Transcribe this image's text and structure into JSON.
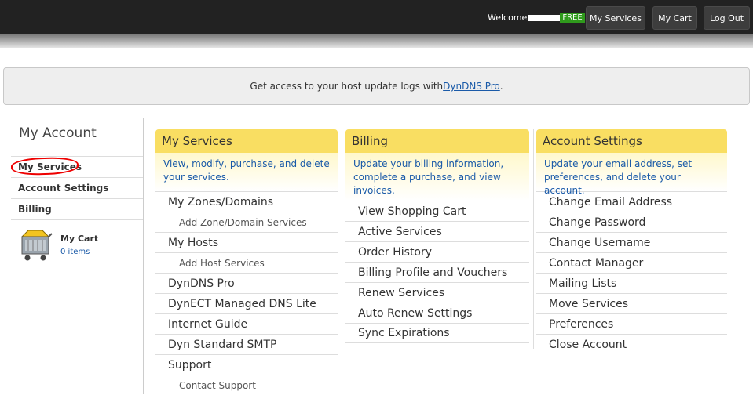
{
  "topbar": {
    "welcome_label": "Welcome",
    "badge": "FREE",
    "buttons": [
      "My Services",
      "My Cart",
      "Log Out"
    ]
  },
  "banner": {
    "text_before": "Get access to your host update logs with ",
    "link": "DynDNS Pro",
    "text_after": "."
  },
  "sidebar": {
    "title": "My Account",
    "links": [
      "My Services",
      "Account Settings",
      "Billing"
    ],
    "cart_title": "My Cart",
    "cart_items": "0 items"
  },
  "columns": [
    {
      "title": "My Services",
      "desc": "View, modify, purchase, and delete your services.",
      "items": [
        {
          "label": "My Zones/Domains",
          "sub": false
        },
        {
          "label": "Add Zone/Domain Services",
          "sub": true
        },
        {
          "label": "My Hosts",
          "sub": false
        },
        {
          "label": "Add Host Services",
          "sub": true
        },
        {
          "label": "DynDNS Pro",
          "sub": false
        },
        {
          "label": "DynECT Managed DNS Lite",
          "sub": false
        },
        {
          "label": "Internet Guide",
          "sub": false
        },
        {
          "label": "Dyn Standard SMTP",
          "sub": false
        },
        {
          "label": "Support",
          "sub": false
        },
        {
          "label": "Contact Support",
          "sub": true
        }
      ]
    },
    {
      "title": "Billing",
      "desc": "Update your billing information, complete a purchase, and view invoices.",
      "items": [
        {
          "label": "View Shopping Cart",
          "sub": false
        },
        {
          "label": "Active Services",
          "sub": false
        },
        {
          "label": "Order History",
          "sub": false
        },
        {
          "label": "Billing Profile and Vouchers",
          "sub": false
        },
        {
          "label": "Renew Services",
          "sub": false
        },
        {
          "label": "Auto Renew Settings",
          "sub": false
        },
        {
          "label": "Sync Expirations",
          "sub": false
        }
      ]
    },
    {
      "title": "Account Settings",
      "desc": "Update your email address, set preferences, and delete your account.",
      "items": [
        {
          "label": "Change Email Address",
          "sub": false
        },
        {
          "label": "Change Password",
          "sub": false
        },
        {
          "label": "Change Username",
          "sub": false
        },
        {
          "label": "Contact Manager",
          "sub": false
        },
        {
          "label": "Mailing Lists",
          "sub": false
        },
        {
          "label": "Move Services",
          "sub": false
        },
        {
          "label": "Preferences",
          "sub": false
        },
        {
          "label": "Close Account",
          "sub": false
        }
      ]
    }
  ]
}
